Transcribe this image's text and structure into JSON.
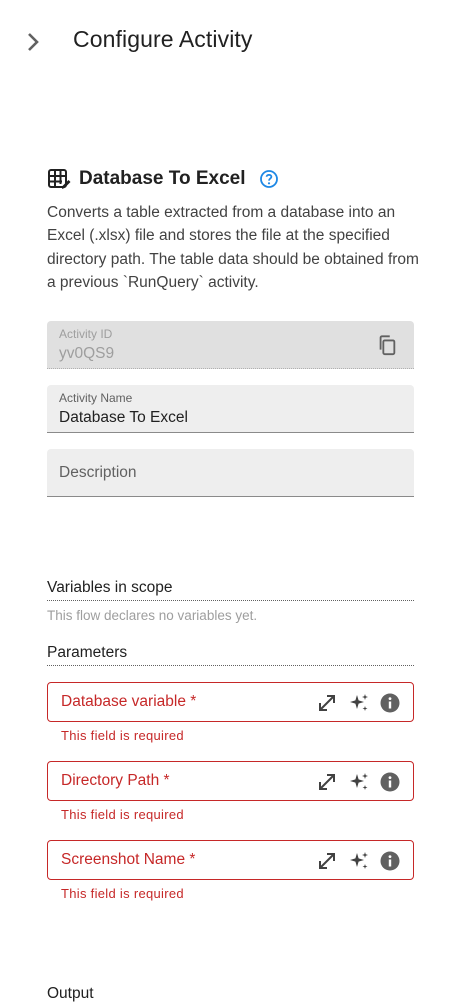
{
  "header": {
    "title": "Configure Activity",
    "collapse_icon": "chevron-right-icon"
  },
  "activity": {
    "icon": "table-edit-icon",
    "title": "Database To Excel",
    "help_icon": "help-circle-icon",
    "description": "Converts a table extracted from a database into an Excel (.xlsx) file and stores the file at the specified directory path. The table data should be obtained from a previous `RunQuery` activity."
  },
  "fields": {
    "activity_id": {
      "label": "Activity ID",
      "value": "yv0QS9",
      "icon": "copy-icon"
    },
    "activity_name": {
      "label": "Activity Name",
      "value": "Database To Excel"
    },
    "description": {
      "placeholder": "Description"
    }
  },
  "variables": {
    "title": "Variables in scope",
    "empty_text": "This flow declares no variables yet."
  },
  "parameters": {
    "title": "Parameters",
    "items": [
      {
        "label": "Database variable *",
        "error": "This field is required"
      },
      {
        "label": "Directory Path *",
        "error": "This field is required"
      },
      {
        "label": "Screenshot Name *",
        "error": "This field is required"
      }
    ],
    "icons": [
      "expand-icon",
      "sparkle-icon",
      "info-icon"
    ]
  },
  "output": {
    "title": "Output"
  },
  "colors": {
    "error": "#c62828",
    "help": "#1e88e5",
    "field_bg": "#eeeeee",
    "disabled_bg": "#e0e0e0"
  }
}
